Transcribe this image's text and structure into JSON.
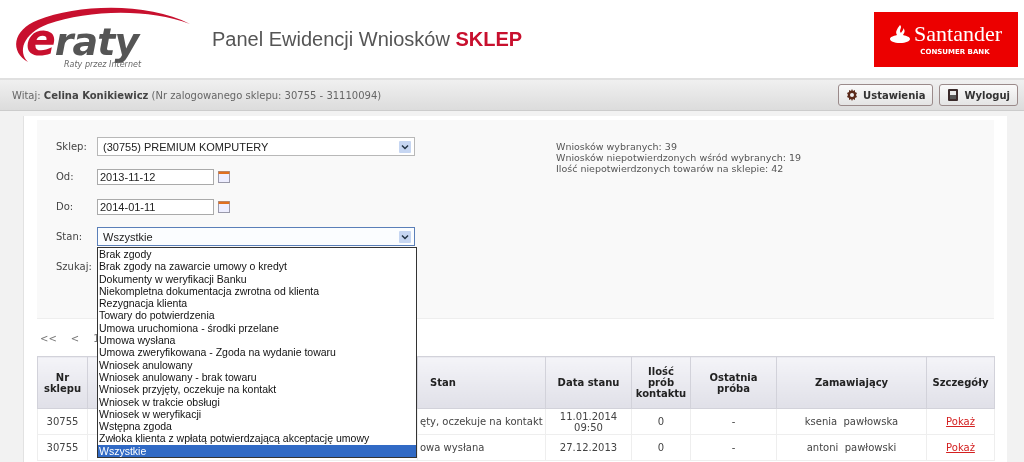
{
  "header": {
    "logo": {
      "mark": "e",
      "word": "raty",
      "tagline": "Raty przez Internet"
    },
    "title": "Panel Ewidencji Wniosków",
    "title_emphasis": "SKLEP",
    "bank": {
      "name": "Santander",
      "subtitle": "CONSUMER BANK"
    }
  },
  "user_bar": {
    "greeting": "Witaj: **Celina Konikiewicz** (Nr zalogowanego sklepu: 30755 - 31110094)",
    "buttons": [
      {
        "kind": "settings",
        "label": "Ustawienia"
      },
      {
        "kind": "logout",
        "label": "Wyloguj"
      }
    ]
  },
  "filters": [
    {
      "label": "Sklep:",
      "kind": "select",
      "value": "(30755) PREMIUM KOMPUTERY"
    },
    {
      "label": "Od:",
      "kind": "date",
      "value": "2013-11-12"
    },
    {
      "label": "Do:",
      "kind": "date",
      "value": "2014-01-11"
    },
    {
      "label": "Stan:",
      "kind": "select",
      "value": "Wszystkie",
      "expanded": true,
      "options": [
        {
          "label": "Brak zgody",
          "selected": false
        },
        {
          "label": "Brak zgody na zawarcie umowy o kredyt",
          "selected": false
        },
        {
          "label": "Dokumenty w weryfikacji Banku",
          "selected": false
        },
        {
          "label": "Niekompletna dokumentacja zwrotna od klienta",
          "selected": false
        },
        {
          "label": "Rezygnacja klienta",
          "selected": false
        },
        {
          "label": "Towary do potwierdzenia",
          "selected": false
        },
        {
          "label": "Umowa uruchomiona - środki przelane",
          "selected": false
        },
        {
          "label": "Umowa wysłana",
          "selected": false
        },
        {
          "label": "Umowa zweryfikowana - Zgoda na wydanie towaru",
          "selected": false
        },
        {
          "label": "Wniosek anulowany",
          "selected": false
        },
        {
          "label": "Wniosek anulowany - brak towaru",
          "selected": false
        },
        {
          "label": "Wniosek przyjęty, oczekuje na kontakt",
          "selected": false
        },
        {
          "label": "Wniosek w trakcie obsługi",
          "selected": false
        },
        {
          "label": "Wniosek w weryfikacji",
          "selected": false
        },
        {
          "label": "Wstępna zgoda",
          "selected": false
        },
        {
          "label": "Zwłoka klienta z wpłatą potwierdzającą akceptację umowy",
          "selected": false
        },
        {
          "label": "Wszystkie",
          "selected": true
        }
      ]
    },
    {
      "label": "Szukaj:",
      "kind": "label"
    }
  ],
  "stats": [
    "Wniosków wybranych: 39",
    "Wniosków niepotwierdzonych wśród wybranych: 19",
    "Ilość niepotwierdzonych towarów na sklepie: 42"
  ],
  "pagination": [
    "<<",
    "<",
    "1"
  ],
  "table": {
    "columns": [
      "Nr sklepu",
      "Stan",
      "Data stanu",
      "Ilość prób kontaktu",
      "Ostatnia próba",
      "Zamawiający",
      "Szczegóły"
    ],
    "rows": [
      {
        "cells": [
          "30755",
          "ęty, oczekuje na kontakt",
          "11.01.2014 09:50",
          "0",
          "-",
          "ksenia  pawłowska"
        ],
        "link": "Pokaż"
      },
      {
        "cells": [
          "30755",
          "owa wysłana",
          "27.12.2013",
          "0",
          "-",
          "antoni  pawłowski"
        ],
        "link": "Pokaż"
      }
    ]
  }
}
